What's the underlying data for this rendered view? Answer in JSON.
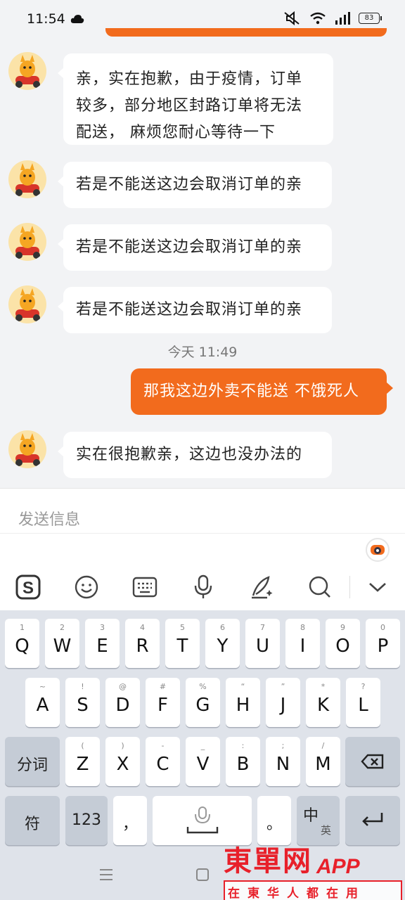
{
  "status_bar": {
    "time": "11:54",
    "battery": "83"
  },
  "messages": [
    {
      "from": "shop",
      "lines": [
        "亲，实在抱歉，由于疫情，订单",
        "较多，部分地区封路订单将无法",
        "配送， 麻烦您耐心等待一下"
      ]
    },
    {
      "from": "shop",
      "text": "若是不能送这边会取消订单的亲"
    },
    {
      "from": "shop",
      "text": "若是不能送这边会取消订单的亲"
    },
    {
      "from": "shop",
      "text": "若是不能送这边会取消订单的亲"
    },
    {
      "from": "me",
      "text": "那我这边外卖不能送 不饿死人"
    },
    {
      "from": "shop",
      "text": "实在很抱歉亲，这边也没办法的"
    }
  ],
  "timestamp": "今天 11:49",
  "input": {
    "placeholder": "发送信息"
  },
  "ime_tools": [
    "sogou-logo-icon",
    "emoji-icon",
    "keyboard-icon",
    "microphone-icon",
    "handwriting-icon",
    "search-icon",
    "collapse-icon"
  ],
  "keyboard": {
    "row1": [
      {
        "main": "Q",
        "sub": "1"
      },
      {
        "main": "W",
        "sub": "2"
      },
      {
        "main": "E",
        "sub": "3"
      },
      {
        "main": "R",
        "sub": "4"
      },
      {
        "main": "T",
        "sub": "5"
      },
      {
        "main": "Y",
        "sub": "6"
      },
      {
        "main": "U",
        "sub": "7"
      },
      {
        "main": "I",
        "sub": "8"
      },
      {
        "main": "O",
        "sub": "9"
      },
      {
        "main": "P",
        "sub": "0"
      }
    ],
    "row2": [
      {
        "main": "A",
        "sub": "~"
      },
      {
        "main": "S",
        "sub": "!"
      },
      {
        "main": "D",
        "sub": "@"
      },
      {
        "main": "F",
        "sub": "#"
      },
      {
        "main": "G",
        "sub": "%"
      },
      {
        "main": "H",
        "sub": "“"
      },
      {
        "main": "J",
        "sub": "”"
      },
      {
        "main": "K",
        "sub": "*"
      },
      {
        "main": "L",
        "sub": "?"
      }
    ],
    "row3": [
      {
        "main": "Z",
        "sub": "("
      },
      {
        "main": "X",
        "sub": ")"
      },
      {
        "main": "C",
        "sub": "-"
      },
      {
        "main": "V",
        "sub": "_"
      },
      {
        "main": "B",
        "sub": ":"
      },
      {
        "main": "N",
        "sub": ";"
      },
      {
        "main": "M",
        "sub": "/"
      }
    ],
    "fenci": "分词",
    "fu": "符",
    "num": "123",
    "comma": "，",
    "period": "。",
    "lang_main": "中",
    "lang_sub": "英"
  },
  "watermark": {
    "title": "東單网",
    "app": "APP",
    "slogan": "在東华人都在用"
  },
  "colors": {
    "accent": "#f26b1d",
    "watermark": "#e8202a"
  }
}
